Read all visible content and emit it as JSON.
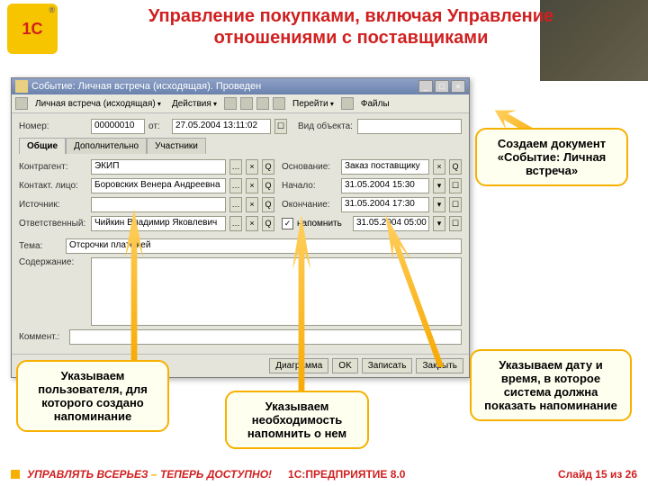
{
  "header": {
    "logo_text": "1C",
    "reg": "®",
    "title_line1": "Управление покупками, включая Управление",
    "title_line2": "отношениями с поставщиками"
  },
  "window": {
    "title": "Событие: Личная встреча (исходящая). Проведен",
    "min": "_",
    "max": "□",
    "close": "×",
    "toolbar": {
      "item1": "Личная встреча (исходящая)",
      "item2": "Действия",
      "item3": "Перейти",
      "item4": "Файлы"
    },
    "form": {
      "num_label": "Номер:",
      "num_value": "00000010",
      "date_label": "от:",
      "date_value": "27.05.2004 13:11:02",
      "vidob_label": "Вид объекта:",
      "vidob_value": "",
      "tabs": {
        "t1": "Общие",
        "t2": "Дополнительно",
        "t3": "Участники"
      },
      "contr_label": "Контрагент:",
      "contr_value": "ЭКИП",
      "contact_label": "Контакт. лицо:",
      "contact_value": "Боровских Венера Андреевна",
      "src_label": "Источник:",
      "src_value": "",
      "resp_label": "Ответственный:",
      "resp_value": "Чийкин Владимир Яковлевич",
      "osn_label": "Основание:",
      "osn_value": "Заказ поставщику",
      "start_label": "Начало:",
      "start_value": "31.05.2004 15:30",
      "end_label": "Окончание:",
      "end_value": "31.05.2004 17:30",
      "remind_label": "напомнить",
      "remind_checked": "✓",
      "remind_value": "31.05.2004 05:00",
      "subject_label": "Тема:",
      "subject_value": "Отсрочки платежей",
      "content_label": "Содержание:",
      "comment_label": "Коммент.:"
    },
    "buttons": {
      "b1": "Диаграмма",
      "b2": "OK",
      "b3": "Записать",
      "b4": "Закрыть"
    }
  },
  "callouts": {
    "c1": "Создаем документ «Событие: Личная встреча»",
    "c2": "Указываем пользователя, для которого создано напоминание",
    "c3": "Указываем необходимость напомнить о нем",
    "c4": "Указываем дату и время, в которое система должна показать напоминание"
  },
  "footer": {
    "left_a": "УПРАВЛЯТЬ ВСЕРЬЕЗ",
    "left_dash": " – ",
    "left_b": "ТЕПЕРЬ ДОСТУПНО!",
    "mid": "1С:ПРЕДПРИЯТИЕ 8.0",
    "right": "Слайд 15 из 26"
  }
}
